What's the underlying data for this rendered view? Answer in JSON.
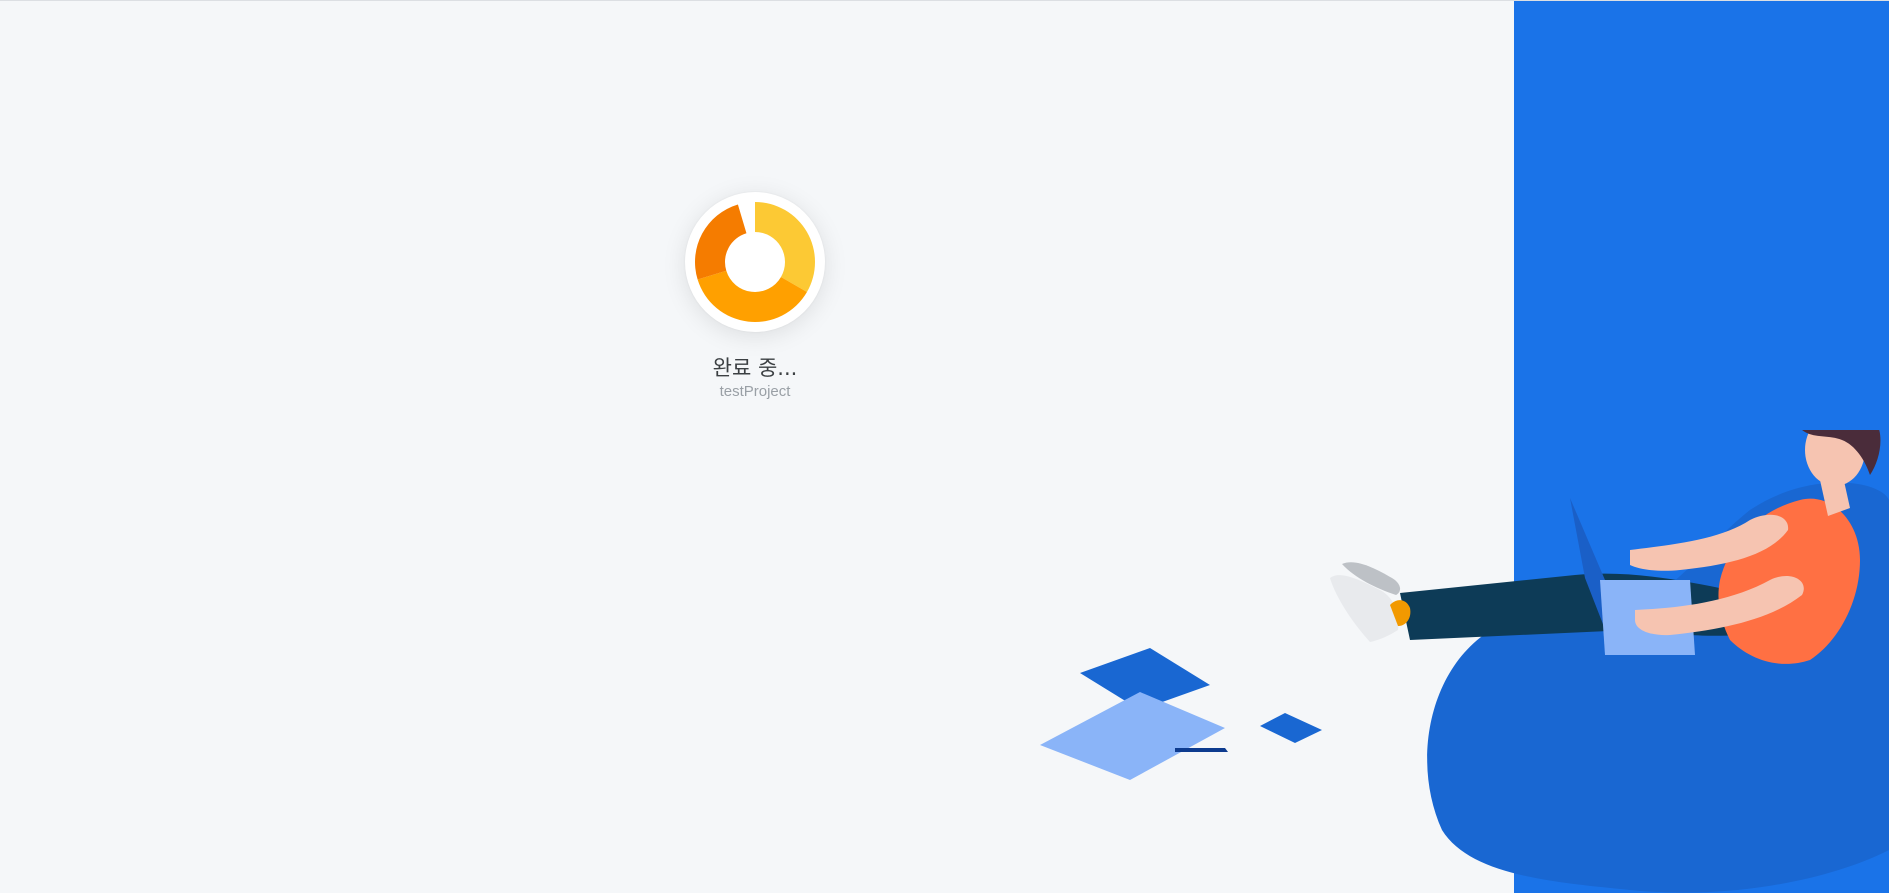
{
  "loading": {
    "status": "완료 중...",
    "project": "testProject",
    "progress_icon": "donut-spinner-icon",
    "colors": {
      "segment_light": "#fcc934",
      "segment_mid": "#ffa000",
      "segment_dark": "#f57c00",
      "disc": "#ffffff"
    }
  },
  "panel": {
    "color": "#1a73e8"
  },
  "background": {
    "color": "#f5f7f9"
  },
  "illustration": {
    "icon": "person-with-laptop-illustration"
  }
}
